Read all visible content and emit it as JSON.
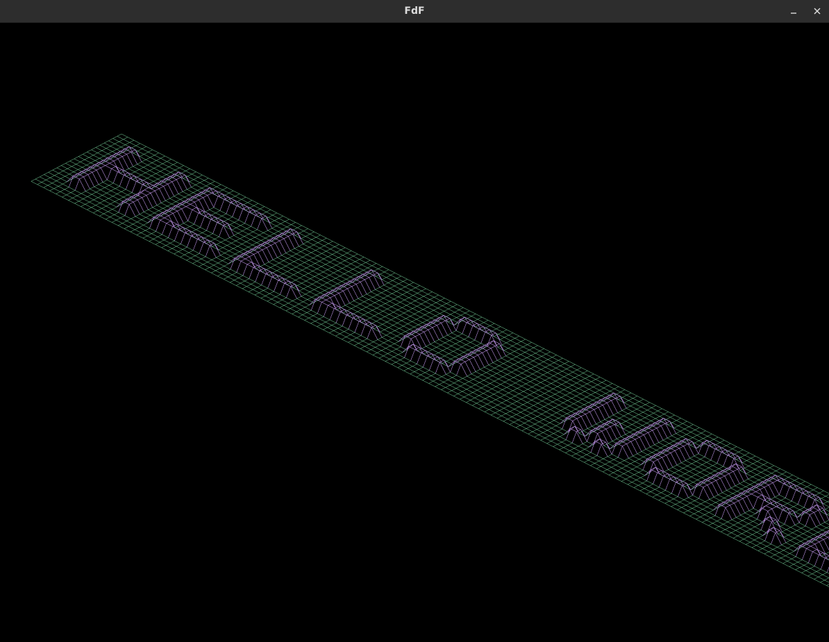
{
  "window": {
    "title": "FdF"
  },
  "colors": {
    "titlebar_bg": "#2d2d2d",
    "title_text": "#dcdcdc",
    "canvas_bg": "#000000",
    "grid_low": "#7fe0a6",
    "grid_high": "#c79bf2"
  },
  "icons": {
    "minimize": "minimize-icon",
    "close": "close-icon"
  },
  "map": {
    "text": "HELLO WORLD",
    "projection": "isometric"
  }
}
